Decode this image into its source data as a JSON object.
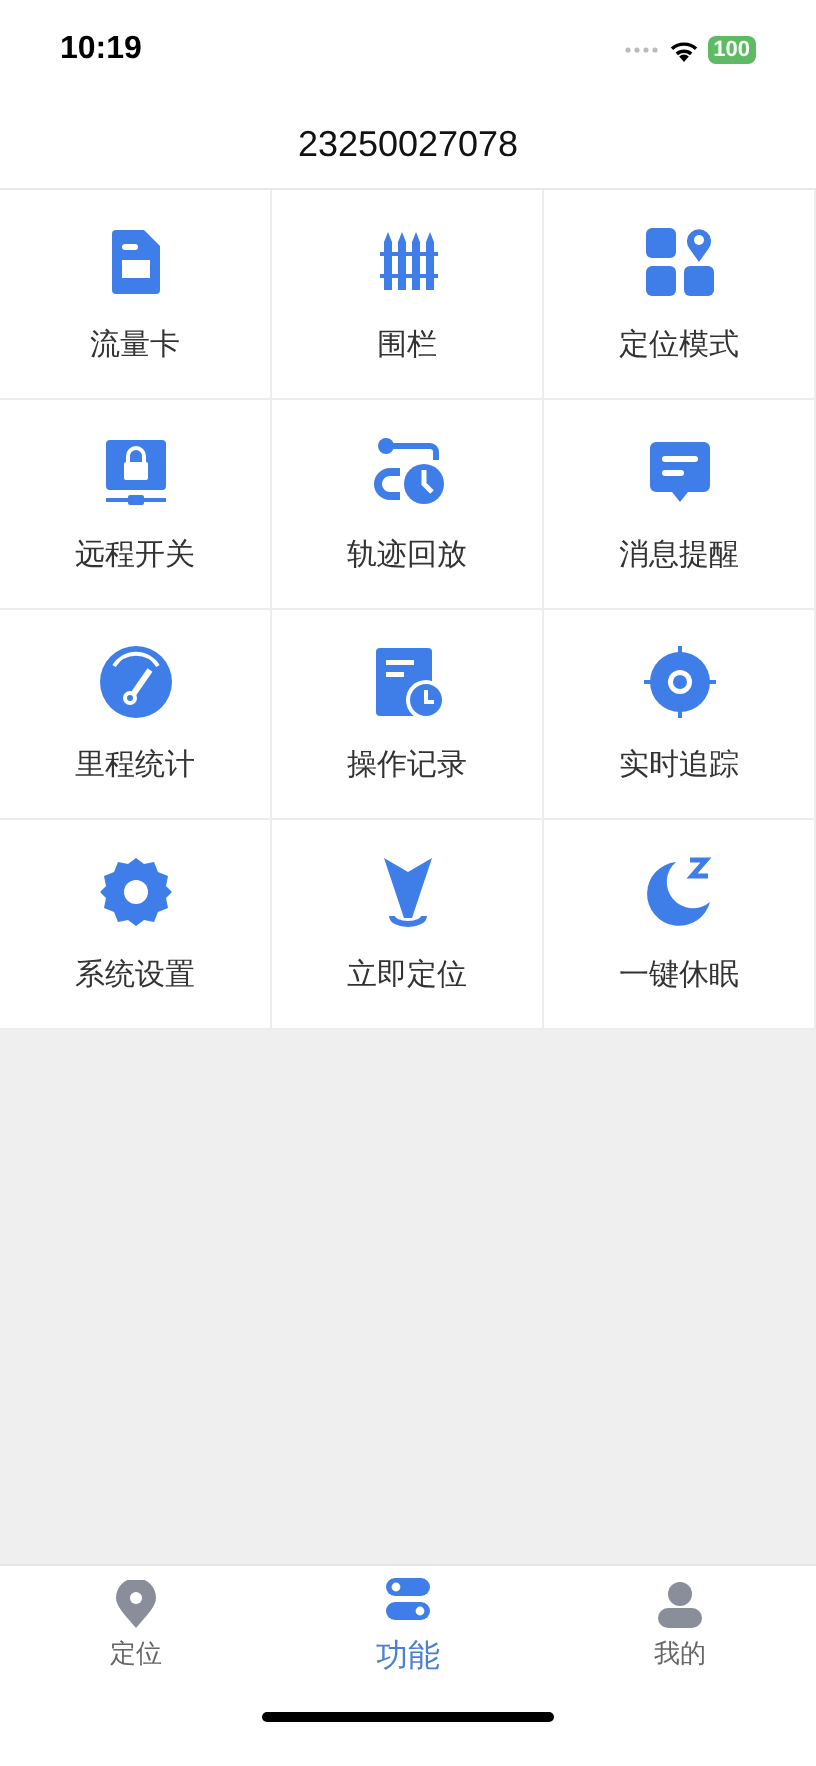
{
  "status_bar": {
    "time": "10:19",
    "battery": "100"
  },
  "title": "23250027078",
  "functions": [
    {
      "label": "流量卡"
    },
    {
      "label": "围栏"
    },
    {
      "label": "定位模式"
    },
    {
      "label": "远程开关"
    },
    {
      "label": "轨迹回放"
    },
    {
      "label": "消息提醒"
    },
    {
      "label": "里程统计"
    },
    {
      "label": "操作记录"
    },
    {
      "label": "实时追踪"
    },
    {
      "label": "系统设置"
    },
    {
      "label": "立即定位"
    },
    {
      "label": "一键休眠"
    }
  ],
  "tab_bar": [
    {
      "label": "定位",
      "selected": false
    },
    {
      "label": "功能",
      "selected": true
    },
    {
      "label": "我的",
      "selected": false
    }
  ]
}
